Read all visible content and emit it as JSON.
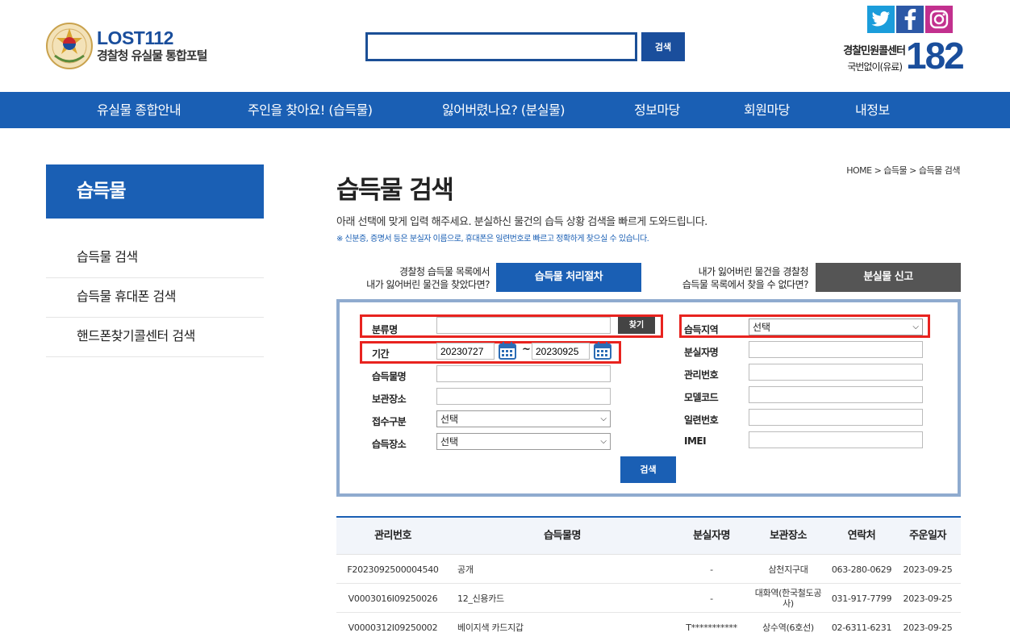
{
  "header": {
    "logo_title": "LOST112",
    "logo_subtitle": "경찰청 유실물 통합포털",
    "search_button": "검색",
    "search_value": "",
    "call_label": "경찰민원콜센터",
    "call_sub": "국번없이(유료)",
    "call_number": "182"
  },
  "nav": [
    "유실물 종합안내",
    "주인을 찾아요! (습득물)",
    "잃어버렸나요? (분실물)",
    "정보마당",
    "회원마당",
    "내정보"
  ],
  "sidebar": {
    "title": "습득물",
    "items": [
      "습득물 검색",
      "습득물 휴대폰 검색",
      "핸드폰찾기콜센터 검색"
    ]
  },
  "breadcrumb": [
    "HOME",
    "습득물",
    "습득물 검색"
  ],
  "page": {
    "title": "습득물 검색",
    "description": "아래 선택에 맞게 입력 해주세요. 분실하신 물건의 습득 상황 검색을 빠르게 도와드립니다.",
    "note": "※ 신분증, 증명서 등은 분실자 이름으로, 휴대폰은 일련번호로 빠르고 정확하게 찾으실 수 있습니다."
  },
  "promo": {
    "left_line1": "경찰청 습득물 목록에서",
    "left_line2": "내가 잃어버린 물건을 찾았다면?",
    "left_button": "습득물 처리절차",
    "right_line1": "내가 잃어버린 물건을 경찰청",
    "right_line2": "습득물 목록에서 찾을 수 없다면?",
    "right_button": "분실물 신고"
  },
  "form": {
    "category_label": "분류명",
    "category_value": "",
    "find_button": "찾기",
    "period_label": "기간",
    "date_from": "20230727",
    "date_tilde": "~",
    "date_to": "20230925",
    "item_name_label": "습득물명",
    "storage_label": "보관장소",
    "receipt_label": "접수구분",
    "receipt_value": "선택",
    "place_label": "습득장소",
    "place_value": "선택",
    "region_label": "습득지역",
    "region_value": "선택",
    "owner_label": "분실자명",
    "mgmt_label": "관리번호",
    "model_label": "모델코드",
    "serial_label": "일련번호",
    "imei_label": "IMEI",
    "search_button": "검색"
  },
  "table": {
    "headers": [
      "관리번호",
      "습득물명",
      "분실자명",
      "보관장소",
      "연락처",
      "주운일자"
    ],
    "rows": [
      [
        "F2023092500004540",
        "공개",
        "-",
        "삼천지구대",
        "063-280-0629",
        "2023-09-25"
      ],
      [
        "V0003016I09250026",
        "12_신용카드",
        "-",
        "대화역(한국철도공사)",
        "031-917-7799",
        "2023-09-25"
      ],
      [
        "V0000312I09250002",
        "베이지색 카드지갑",
        "T***********",
        "상수역(6호선)",
        "02-6311-6231",
        "2023-09-25"
      ]
    ]
  },
  "colors": {
    "primary": "#1a5fb4",
    "highlight": "#e8231f",
    "dark_button": "#555555"
  }
}
